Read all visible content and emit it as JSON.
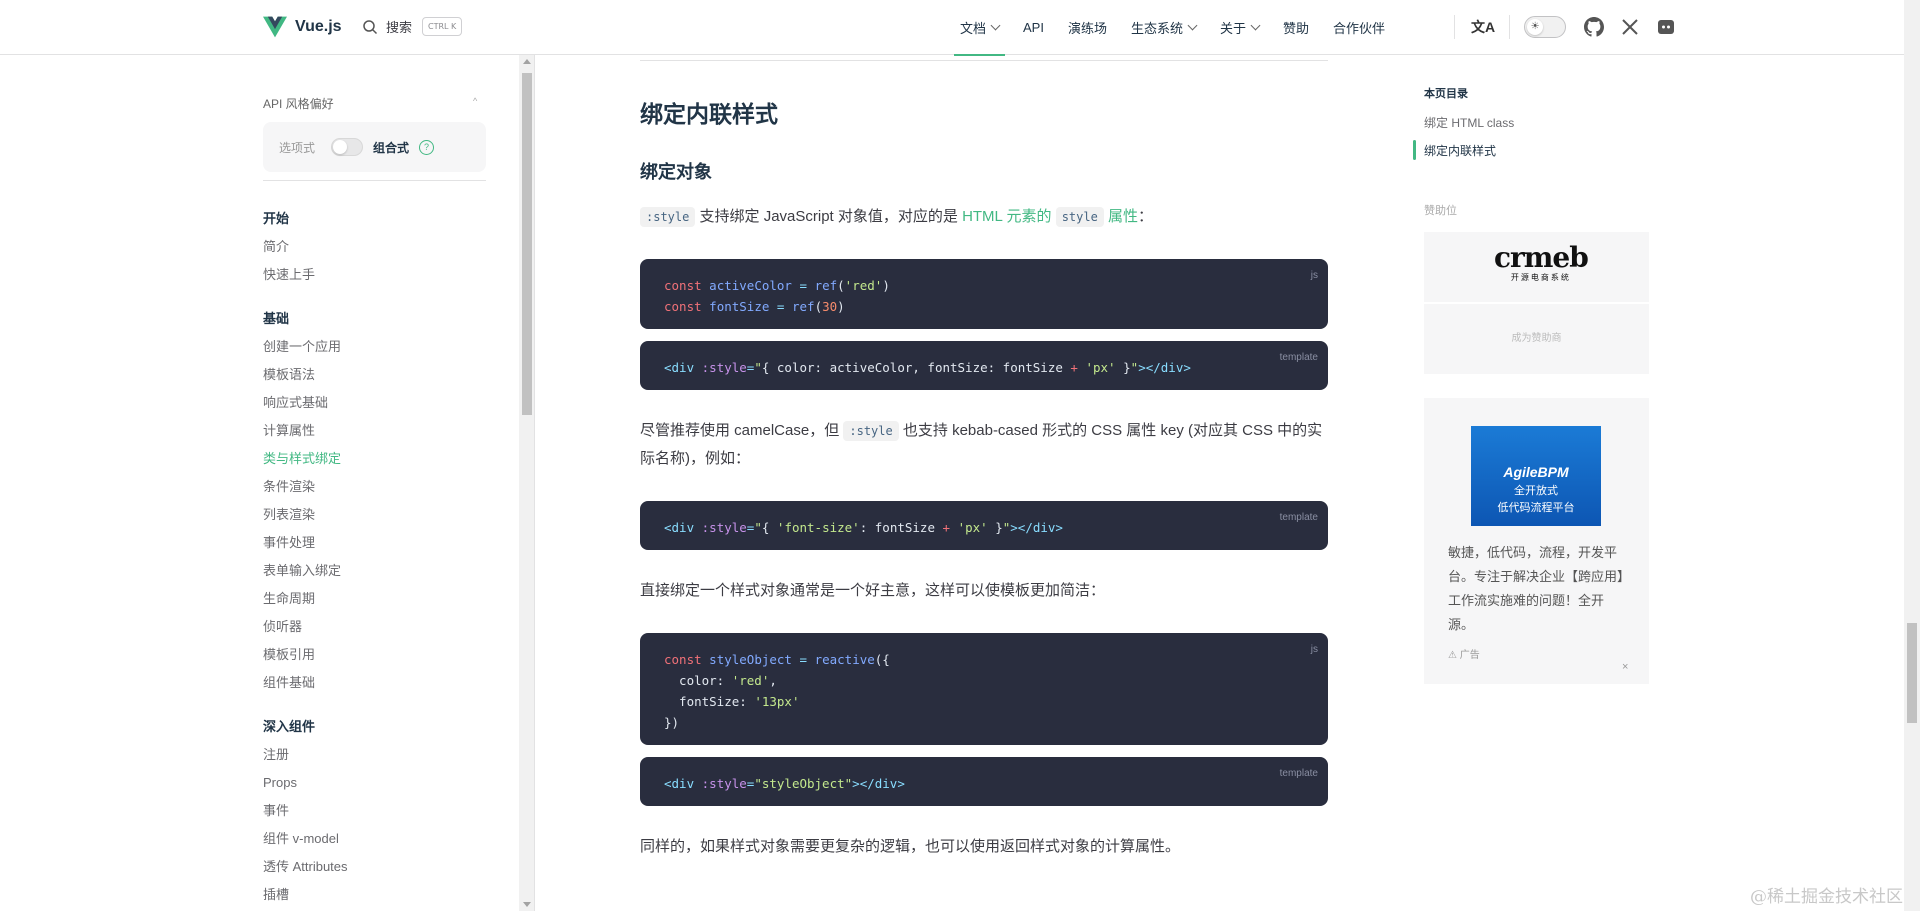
{
  "header": {
    "logo_text": "Vue.js",
    "search_label": "搜索",
    "search_shortcut": "CTRL K",
    "nav": [
      {
        "label": "文档",
        "dropdown": true,
        "active": true
      },
      {
        "label": "API",
        "dropdown": false
      },
      {
        "label": "演练场",
        "dropdown": false
      },
      {
        "label": "生态系统",
        "dropdown": true
      },
      {
        "label": "关于",
        "dropdown": true
      },
      {
        "label": "赞助",
        "dropdown": false
      },
      {
        "label": "合作伙伴",
        "dropdown": false
      }
    ],
    "translate_glyph": "文A",
    "theme_glyph": "☀"
  },
  "sidebar": {
    "pref_title": "API 风格偏好",
    "pref_option": "选项式",
    "pref_selected": "组合式",
    "help_glyph": "?",
    "sections": [
      {
        "title": "开始",
        "items": [
          "简介",
          "快速上手"
        ]
      },
      {
        "title": "基础",
        "items": [
          "创建一个应用",
          "模板语法",
          "响应式基础",
          "计算属性",
          "类与样式绑定",
          "条件渲染",
          "列表渲染",
          "事件处理",
          "表单输入绑定",
          "生命周期",
          "侦听器",
          "模板引用",
          "组件基础"
        ]
      },
      {
        "title": "深入组件",
        "items": [
          "注册",
          "Props",
          "事件",
          "组件 v-model",
          "透传 Attributes",
          "插槽"
        ]
      }
    ],
    "active_item": "类与样式绑定"
  },
  "main": {
    "heading": "绑定内联样式",
    "subheading": "绑定对象",
    "p1": {
      "code1": ":style",
      "text1": " 支持绑定 JavaScript 对象值，对应的是 ",
      "link1": "HTML 元素的 ",
      "code2": "style",
      "link2": " 属性",
      "text2": "："
    },
    "code_js1": {
      "lang": "js"
    },
    "code_tpl1": {
      "lang": "template"
    },
    "p2": {
      "text1": "尽管推荐使用 camelCase，但 ",
      "code1": ":style",
      "text2": " 也支持 kebab-cased 形式的 CSS 属性 key (对应其 CSS 中的实际名称)，例如："
    },
    "code_tpl2": {
      "lang": "template"
    },
    "p3": "直接绑定一个样式对象通常是一个好主意，这样可以使模板更加简洁：",
    "code_js2": {
      "lang": "js"
    },
    "code_tpl3": {
      "lang": "template"
    },
    "p4": "同样的，如果样式对象需要更复杂的逻辑，也可以使用返回样式对象的计算属性。"
  },
  "aside": {
    "toc_title": "本页目录",
    "toc_items": [
      "绑定 HTML class",
      "绑定内联样式"
    ],
    "toc_active": "绑定内联样式",
    "sponsor_label": "赞助位",
    "sponsor_logo": "crmeb",
    "sponsor_logo_sub": "开源电商系统",
    "become_sponsor": "成为赞助商",
    "ad_brand": "AgileBPM",
    "ad_line1": "全开放式",
    "ad_line2": "低代码流程平台",
    "ad_text": "敏捷，低代码，流程，开发平台。专注于解决企业【跨应用】工作流实施难的问题！全开源。",
    "ad_label": "广告",
    "ad_close": "×"
  },
  "watermark": "@稀土掘金技术社区",
  "colors": {
    "accent": "#42b883",
    "code_bg": "#292d3e",
    "text": "#213547"
  }
}
